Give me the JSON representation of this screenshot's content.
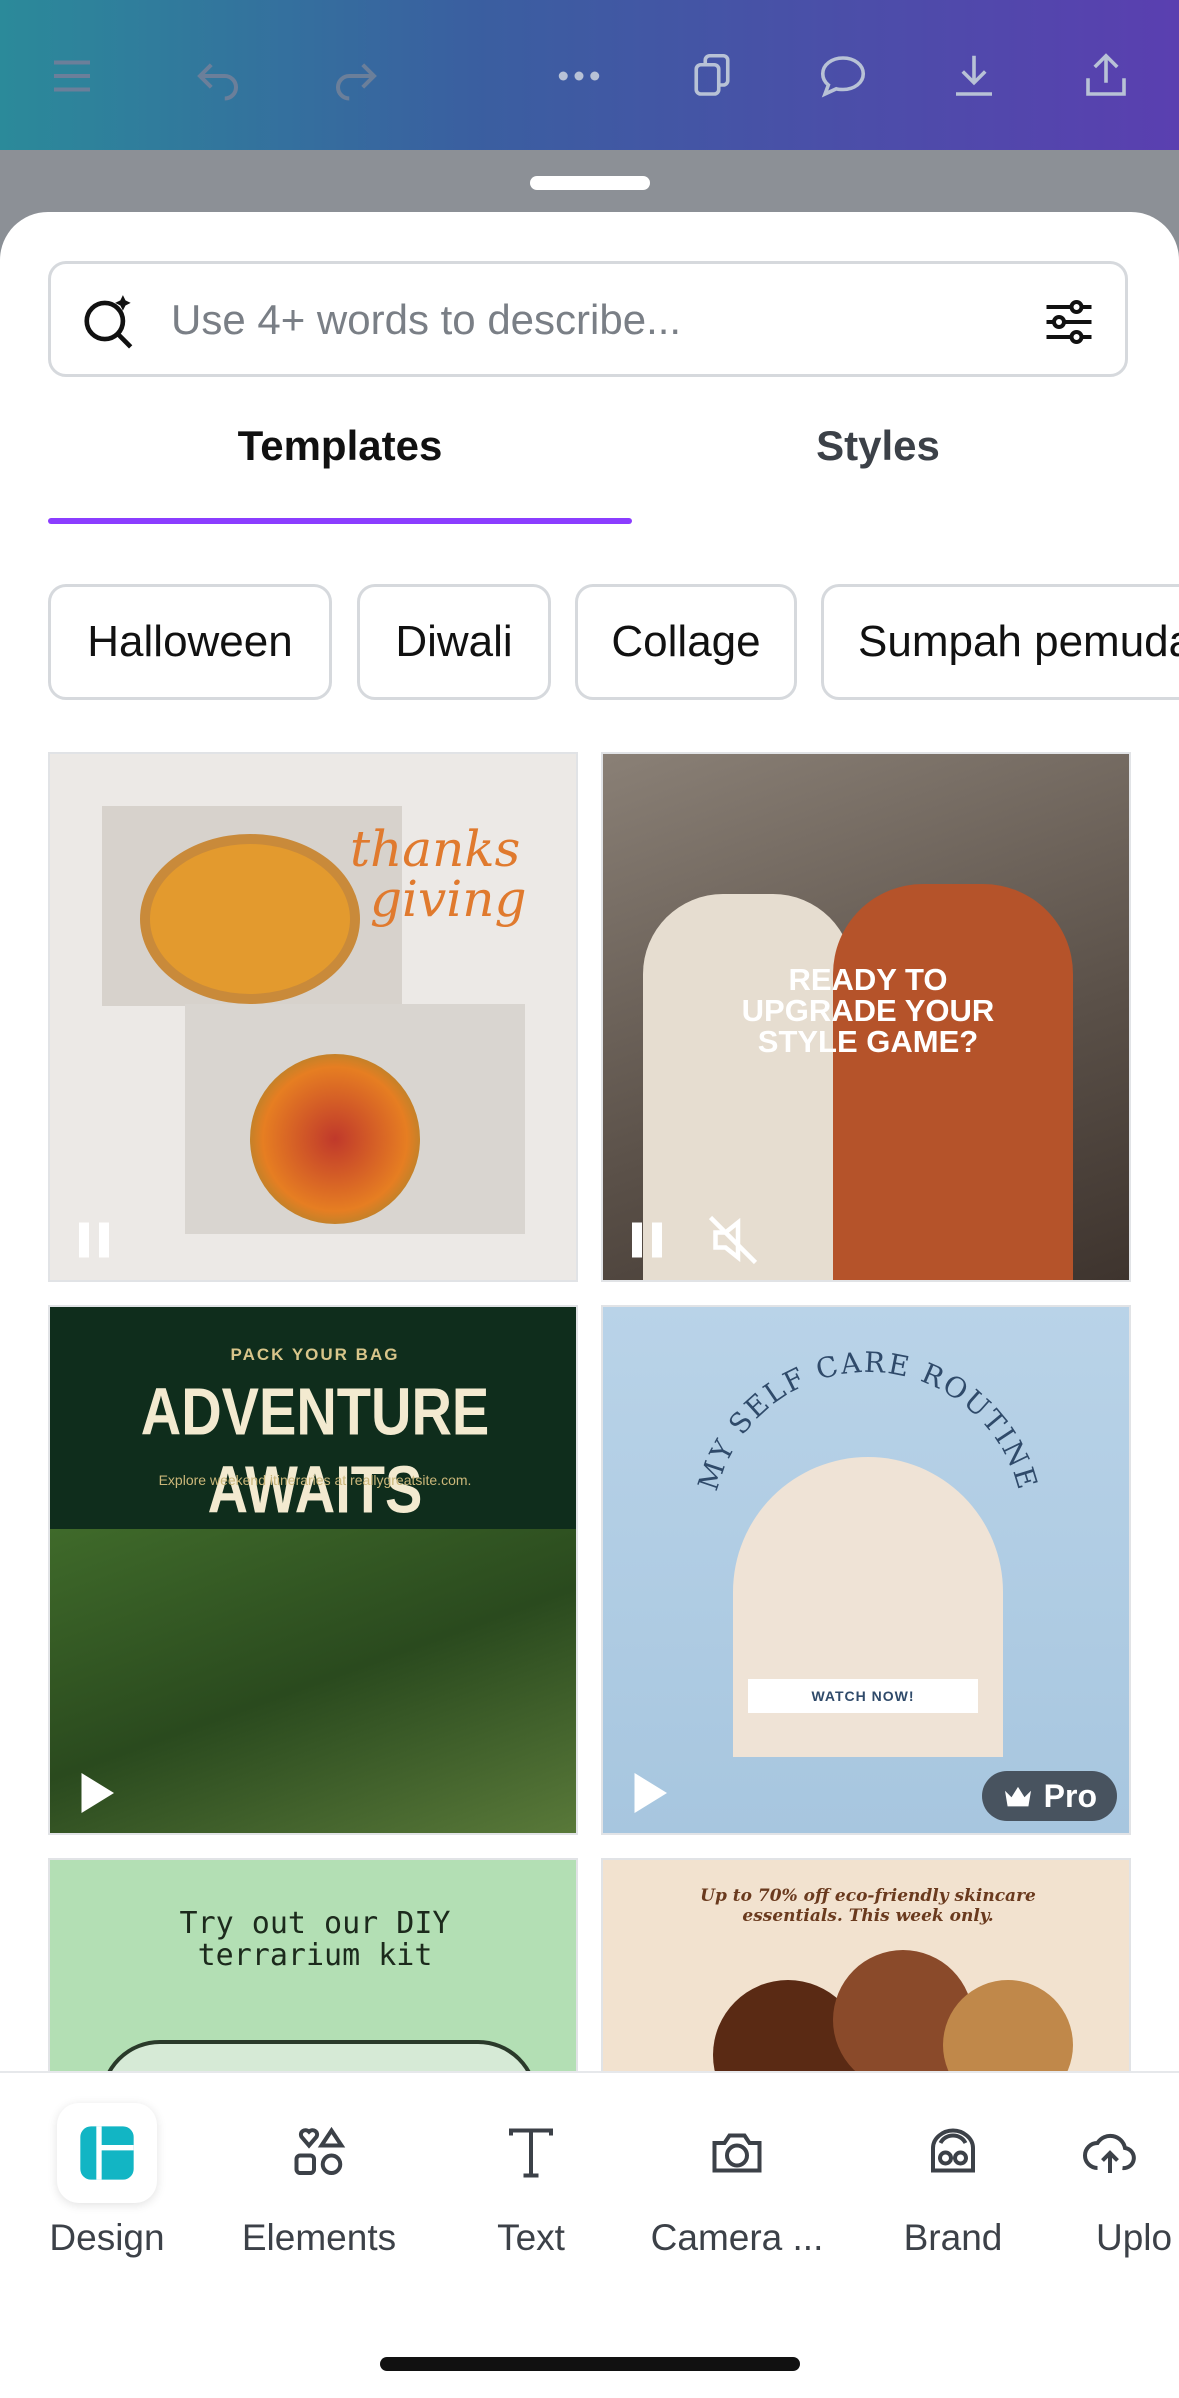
{
  "toolbar": {
    "icons": [
      "menu-icon",
      "undo-icon",
      "redo-icon",
      "more-icon",
      "pages-icon",
      "comment-icon",
      "download-icon",
      "share-icon"
    ]
  },
  "search": {
    "placeholder": "Use 4+ words to describe..."
  },
  "tabs": [
    {
      "label": "Templates",
      "active": true
    },
    {
      "label": "Styles",
      "active": false
    }
  ],
  "chips": [
    "Halloween",
    "Diwali",
    "Collage",
    "Sumpah pemuda"
  ],
  "templates": [
    {
      "lines": [
        "thanks",
        "giving"
      ]
    },
    {
      "lines": [
        "READY TO",
        "UPGRADE YOUR",
        "STYLE GAME?"
      ]
    },
    {
      "kicker": "PACK YOUR BAG",
      "title": "ADVENTURE AWAITS",
      "sub": "Explore weekend itineraries at reallygreatsite.com."
    },
    {
      "arc": "MY SELF CARE ROUTINE",
      "cta": "WATCH NOW!",
      "badge": "Pro"
    },
    {
      "lines": [
        "Try out our DIY",
        "terrarium kit"
      ]
    },
    {
      "lines": [
        "Up to 70% off eco-friendly skincare",
        "essentials. This week only."
      ]
    }
  ],
  "bottom_nav": [
    {
      "label": "Design",
      "icon": "design-icon",
      "active": true
    },
    {
      "label": "Elements",
      "icon": "elements-icon"
    },
    {
      "label": "Text",
      "icon": "text-icon"
    },
    {
      "label": "Camera ...",
      "icon": "camera-icon"
    },
    {
      "label": "Brand",
      "icon": "brand-icon"
    },
    {
      "label": "Uplo",
      "icon": "upload-icon"
    }
  ],
  "colors": {
    "accent": "#8b3dff",
    "design_active": "#12b5c4"
  }
}
